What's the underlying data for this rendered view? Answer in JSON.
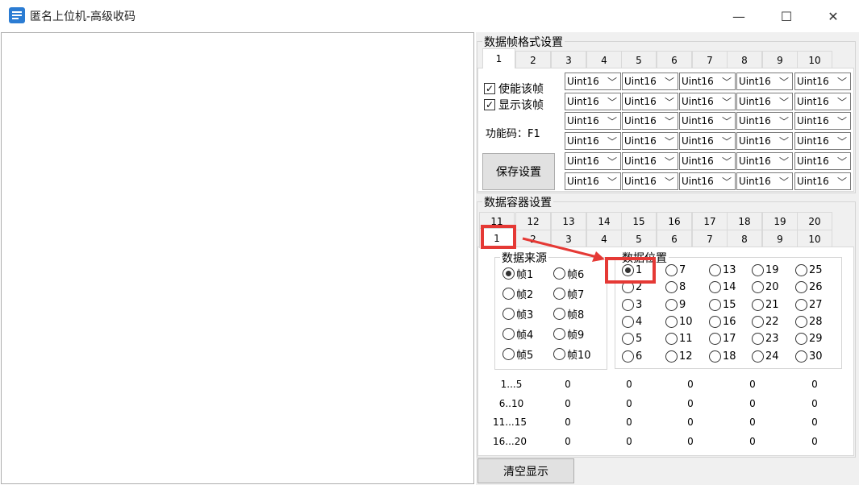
{
  "window": {
    "title": "匿名上位机-高级收码",
    "minimize": "—",
    "maximize": "☐",
    "close": "✕"
  },
  "frame_settings": {
    "title": "数据帧格式设置",
    "tabs": [
      "1",
      "2",
      "3",
      "4",
      "5",
      "6",
      "7",
      "8",
      "9",
      "10"
    ],
    "active_tab": "1",
    "enable_label": "使能该帧",
    "show_label": "显示该帧",
    "function_code_label": "功能码：F1",
    "save_button": "保存设置",
    "dropdown_value": "Uint16"
  },
  "container_settings": {
    "title": "数据容器设置",
    "tabs_row1": [
      "11",
      "12",
      "13",
      "14",
      "15",
      "16",
      "17",
      "18",
      "19",
      "20"
    ],
    "tabs_row2": [
      "1",
      "2",
      "3",
      "4",
      "5",
      "6",
      "7",
      "8",
      "9",
      "10"
    ],
    "active_tab": "1",
    "source": {
      "title": "数据来源",
      "options": [
        "帧1",
        "帧2",
        "帧3",
        "帧4",
        "帧5",
        "帧6",
        "帧7",
        "帧8",
        "帧9",
        "帧10"
      ],
      "selected": "帧1"
    },
    "position": {
      "title": "数据位置",
      "options": [
        "1",
        "2",
        "3",
        "4",
        "5",
        "6",
        "7",
        "8",
        "9",
        "10",
        "11",
        "12",
        "13",
        "14",
        "15",
        "16",
        "17",
        "18",
        "19",
        "20",
        "21",
        "22",
        "23",
        "24",
        "25",
        "26",
        "27",
        "28",
        "29",
        "30"
      ],
      "selected": "1"
    },
    "values_table": {
      "row_labels": [
        "1...5",
        "6..10",
        "11...15",
        "16...20"
      ],
      "rows": [
        [
          "0",
          "0",
          "0",
          "0",
          "0"
        ],
        [
          "0",
          "0",
          "0",
          "0",
          "0"
        ],
        [
          "0",
          "0",
          "0",
          "0",
          "0"
        ],
        [
          "0",
          "0",
          "0",
          "0",
          "0"
        ]
      ]
    }
  },
  "clear_button": "清空显示",
  "colors": {
    "highlight": "#e53935",
    "accent_icon": "#2b7cd3"
  }
}
